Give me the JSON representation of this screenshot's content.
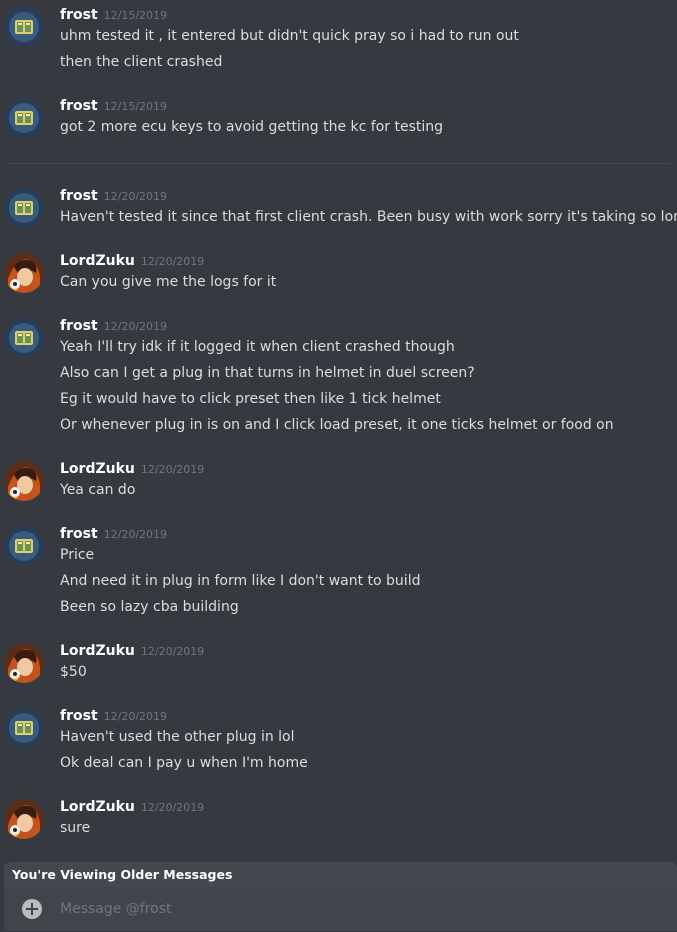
{
  "channel": {
    "recipient": "frost"
  },
  "colors": {
    "background": "#36393f",
    "author": "#ffffff",
    "text": "#dcddde",
    "timestamp": "#72767d",
    "older_bar": "#44474e",
    "composer": "#40444b"
  },
  "messages": [
    {
      "author": "frost",
      "avatar": "frost-avatar",
      "timestamp": "12/15/2019",
      "lines": [
        "uhm tested it , it entered but didn't quick pray so i had to run out",
        "then the client crashed"
      ]
    },
    {
      "author": "frost",
      "avatar": "frost-avatar",
      "timestamp": "12/15/2019",
      "lines": [
        "got 2 more ecu keys to avoid getting the kc for testing"
      ]
    },
    {
      "author": "frost",
      "avatar": "frost-avatar",
      "timestamp": "12/20/2019",
      "lines": [
        "Haven't tested it since that first client crash. Been busy with work sorry it's taking so long."
      ]
    },
    {
      "author": "LordZuku",
      "avatar": "lordzuku-avatar",
      "timestamp": "12/20/2019",
      "lines": [
        "Can you give me the logs for it"
      ]
    },
    {
      "author": "frost",
      "avatar": "frost-avatar",
      "timestamp": "12/20/2019",
      "lines": [
        "Yeah I'll try idk if it logged it when client crashed though",
        "Also can I get a plug in that turns in helmet in duel screen?",
        "Eg it would have to click preset then like 1 tick helmet",
        "Or whenever plug in is on and I click load preset, it one ticks helmet or food on"
      ]
    },
    {
      "author": "LordZuku",
      "avatar": "lordzuku-avatar",
      "timestamp": "12/20/2019",
      "lines": [
        "Yea can do"
      ]
    },
    {
      "author": "frost",
      "avatar": "frost-avatar",
      "timestamp": "12/20/2019",
      "lines": [
        "Price",
        "And need it in plug in form like I don't want to build",
        "Been so lazy cba building"
      ]
    },
    {
      "author": "LordZuku",
      "avatar": "lordzuku-avatar",
      "timestamp": "12/20/2019",
      "lines": [
        "$50"
      ]
    },
    {
      "author": "frost",
      "avatar": "frost-avatar",
      "timestamp": "12/20/2019",
      "lines": [
        "Haven't used the other plug in lol",
        "Ok deal can I pay u when I'm home"
      ]
    },
    {
      "author": "LordZuku",
      "avatar": "lordzuku-avatar",
      "timestamp": "12/20/2019",
      "lines": [
        "sure"
      ]
    }
  ],
  "older_bar": {
    "label": "You're Viewing Older Messages"
  },
  "composer": {
    "add_icon": "plus-circle-icon",
    "placeholder": "Message @frost",
    "value": ""
  }
}
